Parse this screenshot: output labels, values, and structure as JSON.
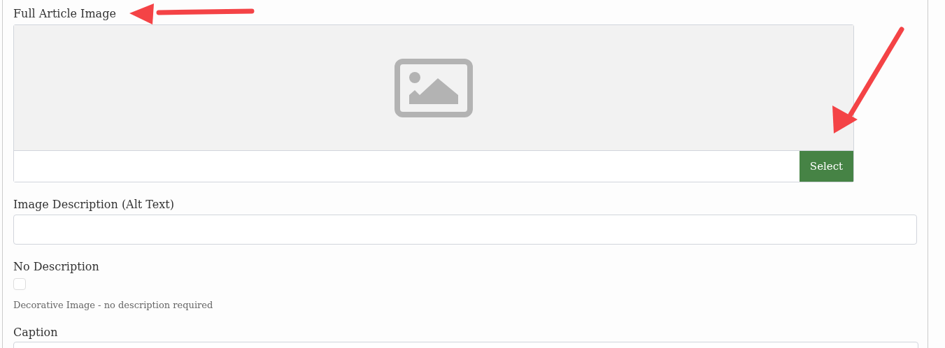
{
  "image_field": {
    "label": "Full Article Image",
    "button": "Select"
  },
  "description_field": {
    "label": "Image Description (Alt Text)"
  },
  "no_description": {
    "label": "No Description",
    "checked": false,
    "help": "Decorative Image - no description required"
  },
  "caption_field": {
    "label": "Caption"
  }
}
